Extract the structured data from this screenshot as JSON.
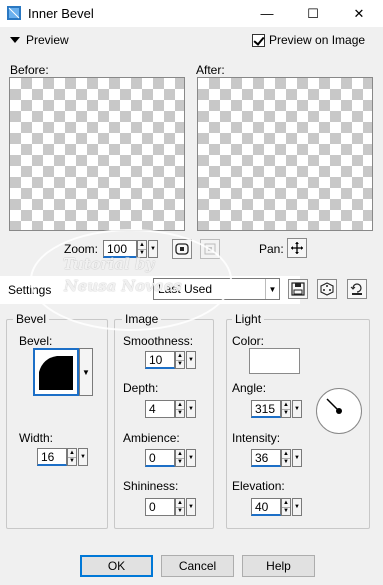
{
  "window": {
    "title": "Inner Bevel",
    "controls": {
      "minimize": "—",
      "maximize": "☐",
      "close": "✕"
    }
  },
  "preview": {
    "toggle_label": "Preview",
    "preview_on_image_label": "Preview on Image",
    "preview_on_image_checked": true,
    "before_label": "Before:",
    "after_label": "After:"
  },
  "zoom": {
    "label": "Zoom:",
    "value": "100",
    "pan_label": "Pan:"
  },
  "settings": {
    "label": "Settings",
    "selected": "Last Used"
  },
  "bevel": {
    "group_title": "Bevel",
    "bevel_label": "Bevel:",
    "width_label": "Width:",
    "width_value": "16"
  },
  "image": {
    "group_title": "Image",
    "smoothness_label": "Smoothness:",
    "smoothness_value": "10",
    "depth_label": "Depth:",
    "depth_value": "4",
    "ambience_label": "Ambience:",
    "ambience_value": "0",
    "shininess_label": "Shininess:",
    "shininess_value": "0"
  },
  "light": {
    "group_title": "Light",
    "color_label": "Color:",
    "color_value": "#ffffff",
    "angle_label": "Angle:",
    "angle_value": "315",
    "intensity_label": "Intensity:",
    "intensity_value": "36",
    "elevation_label": "Elevation:",
    "elevation_value": "40"
  },
  "buttons": {
    "ok": "OK",
    "cancel": "Cancel",
    "help": "Help"
  },
  "watermark": {
    "line1": "Tutorial by",
    "line2": "Neusa Novaes"
  },
  "colors": {
    "accent": "#1c6fc7",
    "window_bg": "#f0f0f0"
  }
}
